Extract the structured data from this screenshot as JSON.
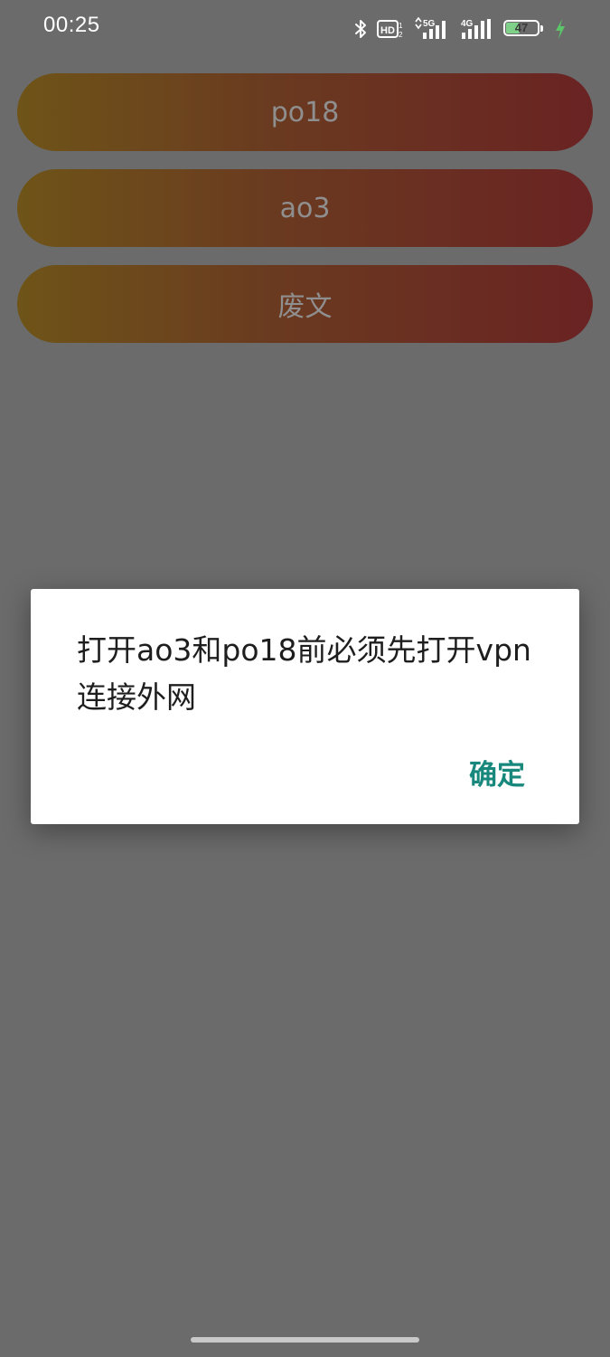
{
  "status_bar": {
    "time": "00:25",
    "icons": [
      "bluetooth-icon",
      "hd-icon",
      "5g-signal-icon",
      "4g-signal-icon",
      "battery-icon",
      "charging-icon"
    ],
    "hd_label": "HD",
    "net1_label": "5G",
    "net2_label": "4G",
    "battery_level": "47",
    "battery_percent": 47,
    "charging_color": "#5cc56a"
  },
  "menu": {
    "items": [
      {
        "label": "po18"
      },
      {
        "label": "ao3"
      },
      {
        "label": "废文"
      }
    ],
    "gradient_start": "#6e5418",
    "gradient_end": "#6a2323"
  },
  "dialog": {
    "message": "打开ao3和po18前必须先打开vpn连接外网",
    "confirm_label": "确定",
    "confirm_color": "#18877c"
  },
  "colors": {
    "scrim_background": "#6b6b6b",
    "dialog_background": "#ffffff"
  }
}
